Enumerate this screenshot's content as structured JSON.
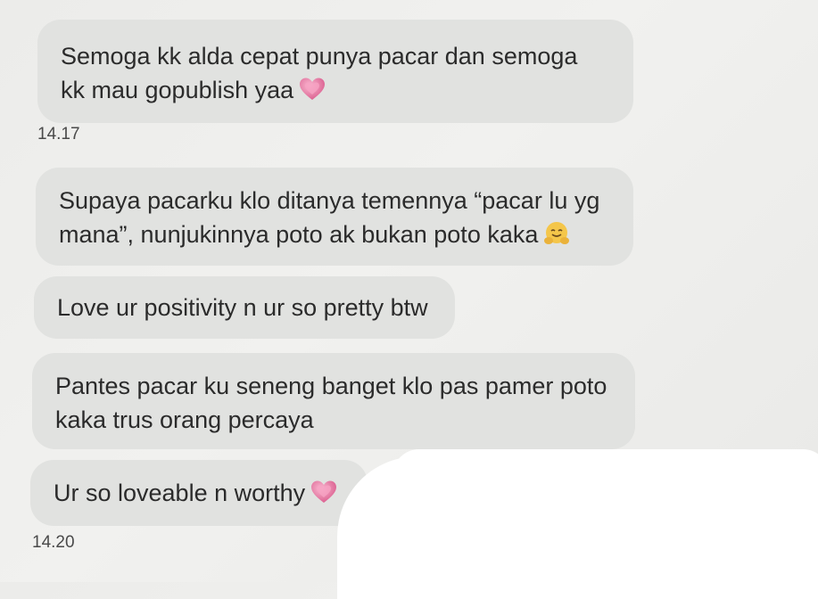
{
  "messages": [
    {
      "text": "Semoga kk alda cepat punya pacar dan semoga kk mau gopublish yaa",
      "emoji": "growing-heart-emoji"
    },
    {
      "text": "Supaya pacarku klo ditanya temennya “pacar lu yg mana”, nunjukinnya poto ak bukan poto kaka",
      "emoji": "hugging-face-emoji"
    },
    {
      "text": "Love ur positivity n ur so pretty btw"
    },
    {
      "text": "Pantes pacar ku seneng banget klo pas pamer poto kaka trus orang percaya"
    },
    {
      "text": "Ur so loveable n worthy",
      "emoji": "growing-heart-emoji"
    }
  ],
  "timestamps": [
    "14.17",
    "14.20"
  ],
  "colors": {
    "bubble": "#e1e2e0",
    "text": "#2b2b2b",
    "heart": "#e56a9a",
    "redaction": "#ffffff"
  }
}
